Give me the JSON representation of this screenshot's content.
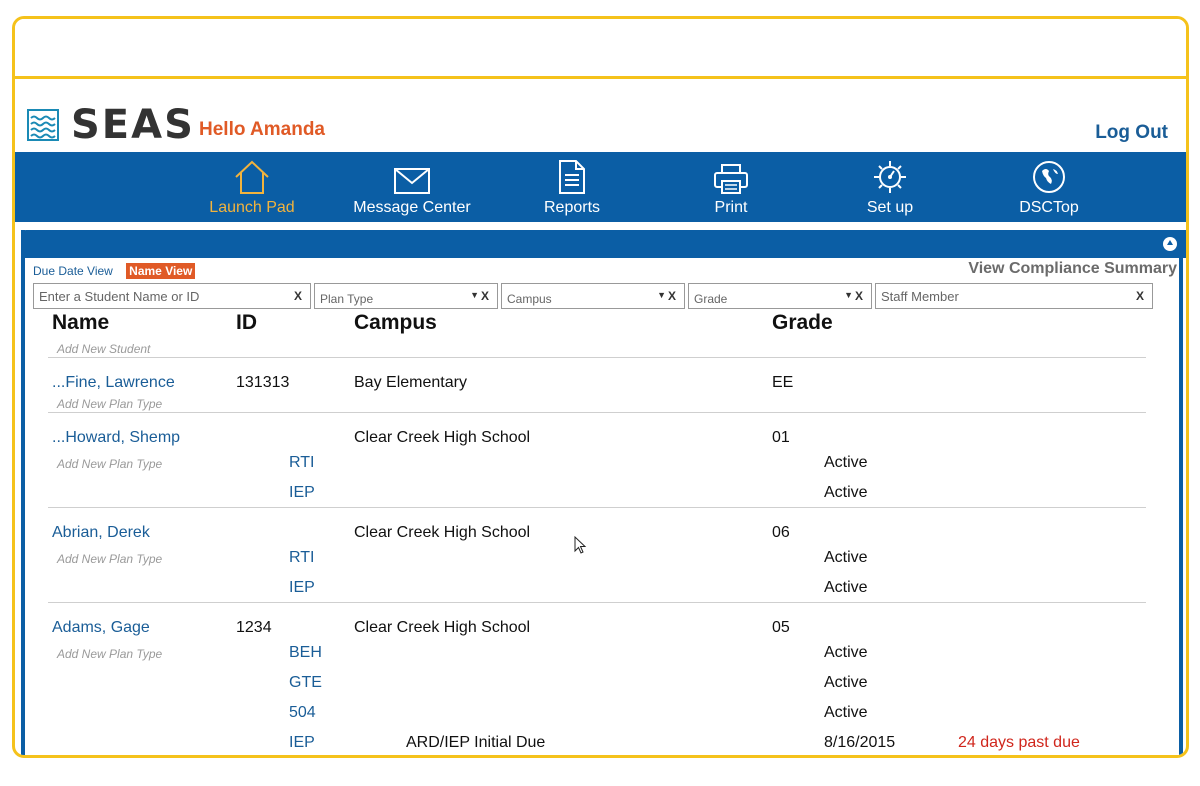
{
  "header": {
    "logo_text": "SEAS",
    "greeting": "Hello Amanda",
    "logout_label": "Log Out"
  },
  "nav": [
    {
      "label": "Launch Pad",
      "icon": "home-icon",
      "active": true
    },
    {
      "label": "Message Center",
      "icon": "envelope-icon"
    },
    {
      "label": "Reports",
      "icon": "document-icon"
    },
    {
      "label": "Print",
      "icon": "printer-icon"
    },
    {
      "label": "Set up",
      "icon": "gear-icon"
    },
    {
      "label": "DSCTop",
      "icon": "globe-icon"
    }
  ],
  "views": {
    "due_date_label": "Due Date View",
    "name_view_label": "Name View",
    "compliance_label": "View Compliance Summary"
  },
  "filters": {
    "student": {
      "placeholder": "Enter a Student Name or ID",
      "clear": "X"
    },
    "plan_type": {
      "placeholder": "Plan Type",
      "clear": "X"
    },
    "campus": {
      "placeholder": "Campus",
      "clear": "X"
    },
    "grade": {
      "placeholder": "Grade",
      "clear": "X"
    },
    "staff": {
      "placeholder": "Staff Member",
      "clear": "X"
    }
  },
  "table": {
    "headers": {
      "name": "Name",
      "id": "ID",
      "campus": "Campus",
      "grade": "Grade"
    },
    "add_new_student": "Add New Student",
    "add_new_plan": "Add New Plan Type",
    "students": [
      {
        "name": "...Fine, Lawrence",
        "id": "131313",
        "campus": "Bay Elementary",
        "grade": "EE",
        "plans": []
      },
      {
        "name": "...Howard, Shemp",
        "id": "",
        "campus": "Clear Creek High School",
        "grade": "01",
        "plans": [
          {
            "type": "RTI",
            "status": "Active"
          },
          {
            "type": "IEP",
            "status": "Active"
          }
        ]
      },
      {
        "name": "Abrian, Derek",
        "id": "",
        "campus": "Clear Creek High School",
        "grade": "06",
        "plans": [
          {
            "type": "RTI",
            "status": "Active"
          },
          {
            "type": "IEP",
            "status": "Active"
          }
        ]
      },
      {
        "name": "Adams, Gage",
        "id": "1234",
        "campus": "Clear Creek High School",
        "grade": "05",
        "plans": [
          {
            "type": "BEH",
            "status": "Active"
          },
          {
            "type": "GTE",
            "status": "Active"
          },
          {
            "type": "504",
            "status": "Active"
          },
          {
            "type": "IEP",
            "event": "ARD/IEP Initial Due",
            "date": "8/16/2015",
            "note": "24 days past due"
          }
        ]
      }
    ]
  },
  "colors": {
    "brand_blue": "#0b5ea5",
    "accent_orange": "#e05a26",
    "frame_yellow": "#f5c21b",
    "past_due_red": "#d0261c"
  }
}
